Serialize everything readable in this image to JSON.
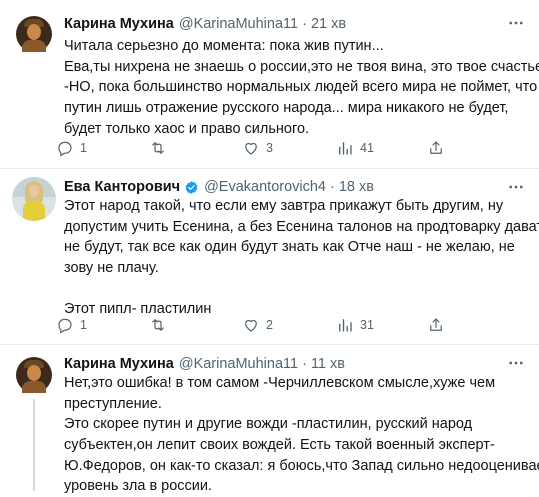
{
  "tweets": [
    {
      "name": "Карина Мухина",
      "handle": "@KarinaMuhina11",
      "time": "21 хв",
      "lines": [
        "Читала серьезно до момента: пока жив путин...",
        "Ева,ты нихрена не знаешь о россии,это не твоя вина, это твое счастье!",
        "-НО, пока большинство нормальных людей всего мира не поймет, что",
        "путин лишь отражение русского народа... мира никакого не будет,",
        "будет только хаос и право сильного."
      ],
      "stats": {
        "reply": "1",
        "retweet": "",
        "like": "3",
        "views": "41"
      }
    },
    {
      "name": "Ева Канторович",
      "handle": "@Evakantorovich4",
      "time": "18 хв",
      "lines": [
        "Этот народ такой, что если ему завтра прикажут быть другим, ну",
        "допустим учить Есенина, а без Есенина талонов на продтоварку давать",
        "не будут, так все как один будут знать как Отче наш - не желаю, не",
        "зову не плачу."
      ],
      "lines2": [
        "Этот пипл- пластилин"
      ],
      "stats": {
        "reply": "1",
        "retweet": "",
        "like": "2",
        "views": "31"
      }
    },
    {
      "name": "Карина Мухина",
      "handle": "@KarinaMuhina11",
      "time": "11 хв",
      "lines": [
        "Нет,это ошибка! в том самом -Черчиллевском смысле,хуже чем",
        "преступление.",
        "Это скорее путин и другие вожди -пластилин, русский народ",
        "субъектен,он лепит своих вождей. Есть такой военный эксперт-",
        "Ю.Федоров, он как-то сказал: я боюсь,что Запад сильно недооценивает",
        "уровень зла в россии."
      ]
    }
  ],
  "colors": {
    "verified": "#1d9bf0",
    "icon": "#536471",
    "text": "#0f1419",
    "divider": "#e6ecf0"
  },
  "icons": [
    "reply-icon",
    "retweet-icon",
    "like-icon",
    "views-icon",
    "share-icon",
    "more-icon",
    "verified-badge-icon"
  ]
}
